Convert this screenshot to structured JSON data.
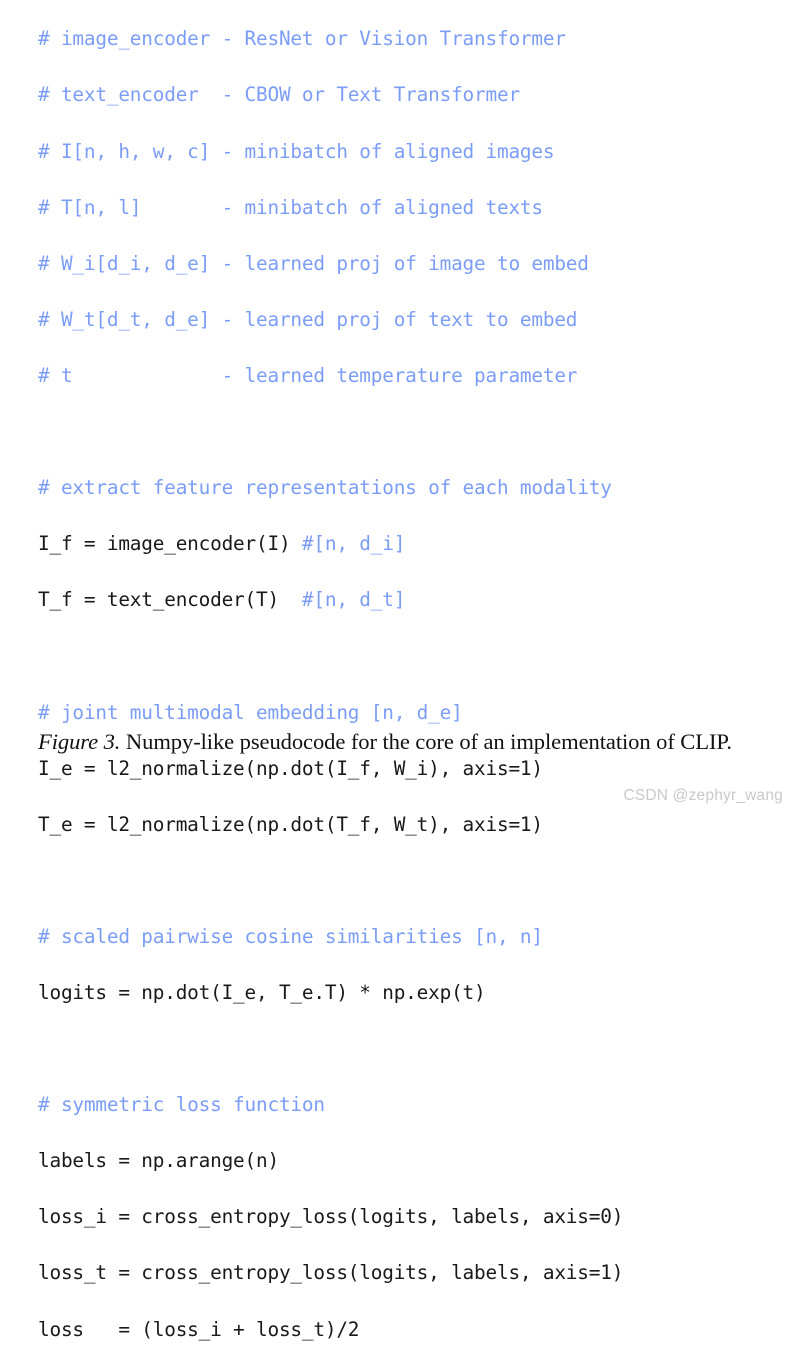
{
  "figure": {
    "colors": {
      "background": "#ffffff",
      "comment": "#7c9df5",
      "code": "#18191b",
      "caption": "#111215",
      "watermark": "#c9c9c9"
    },
    "code": {
      "language": "python-pseudocode",
      "lines": [
        {
          "kind": "comment",
          "text": "# image_encoder - ResNet or Vision Transformer"
        },
        {
          "kind": "comment",
          "text": "# text_encoder  - CBOW or Text Transformer"
        },
        {
          "kind": "comment",
          "text": "# I[n, h, w, c] - minibatch of aligned images"
        },
        {
          "kind": "comment",
          "text": "# T[n, l]       - minibatch of aligned texts"
        },
        {
          "kind": "comment",
          "text": "# W_i[d_i, d_e] - learned proj of image to embed"
        },
        {
          "kind": "comment",
          "text": "# W_t[d_t, d_e] - learned proj of text to embed"
        },
        {
          "kind": "comment",
          "text": "# t             - learned temperature parameter"
        },
        {
          "kind": "blank",
          "text": ""
        },
        {
          "kind": "comment",
          "text": "# extract feature representations of each modality"
        },
        {
          "kind": "mixed",
          "code": "I_f = image_encoder(I) ",
          "comment": "#[n, d_i]"
        },
        {
          "kind": "mixed",
          "code": "T_f = text_encoder(T)  ",
          "comment": "#[n, d_t]"
        },
        {
          "kind": "blank",
          "text": ""
        },
        {
          "kind": "mixed",
          "code": "",
          "comment": "# joint multimodal embedding [n, d_e]"
        },
        {
          "kind": "code",
          "text": "I_e = l2_normalize(np.dot(I_f, W_i), axis=1)"
        },
        {
          "kind": "code",
          "text": "T_e = l2_normalize(np.dot(T_f, W_t), axis=1)"
        },
        {
          "kind": "blank",
          "text": ""
        },
        {
          "kind": "mixed",
          "code": "",
          "comment": "# scaled pairwise cosine similarities [n, n]"
        },
        {
          "kind": "code",
          "text": "logits = np.dot(I_e, T_e.T) * np.exp(t)"
        },
        {
          "kind": "blank",
          "text": ""
        },
        {
          "kind": "comment",
          "text": "# symmetric loss function"
        },
        {
          "kind": "code",
          "text": "labels = np.arange(n)"
        },
        {
          "kind": "code",
          "text": "loss_i = cross_entropy_loss(logits, labels, axis=0)"
        },
        {
          "kind": "code",
          "text": "loss_t = cross_entropy_loss(logits, labels, axis=1)"
        },
        {
          "kind": "code",
          "text": "loss   = (loss_i + loss_t)/2"
        }
      ]
    },
    "caption": {
      "label": "Figure 3.",
      "text": " Numpy-like pseudocode for the core of an implementation of CLIP."
    },
    "watermark": {
      "text": "CSDN @zephyr_wang"
    }
  }
}
